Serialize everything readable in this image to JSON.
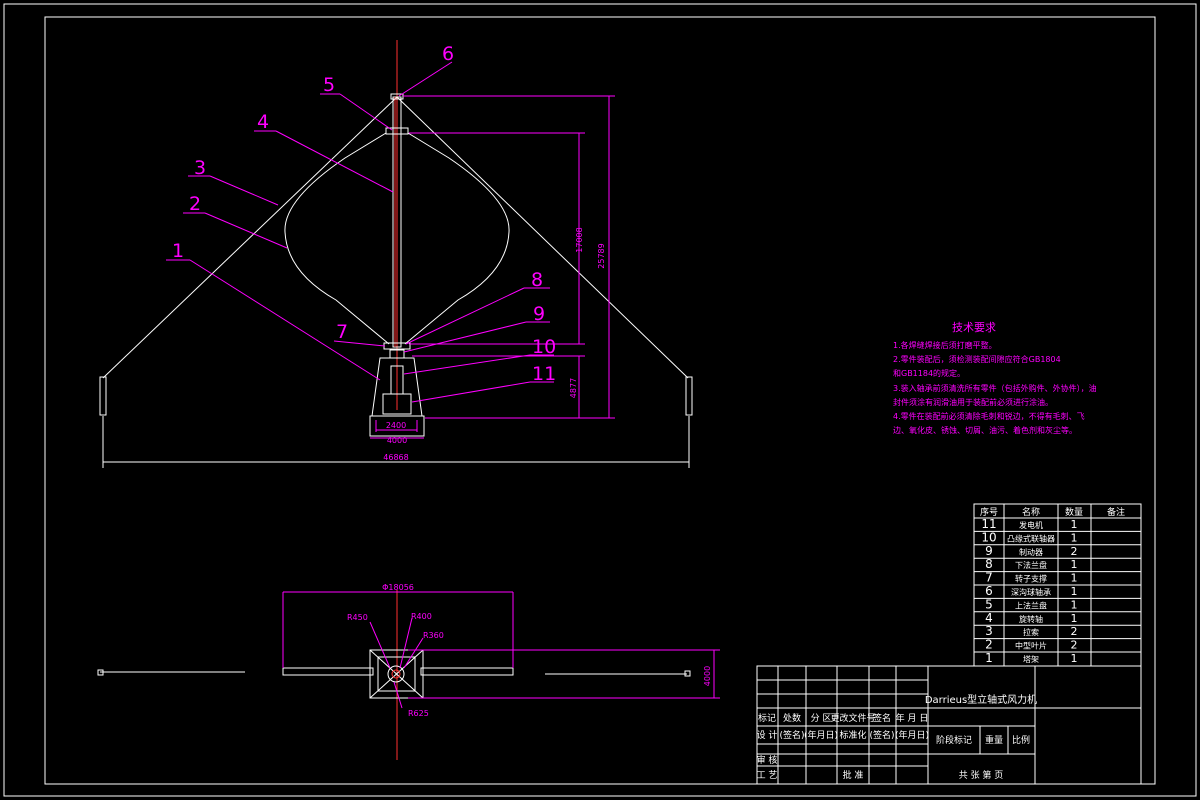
{
  "drawing": {
    "callouts": [
      "6",
      "5",
      "4",
      "3",
      "2",
      "1",
      "7",
      "8",
      "9",
      "10",
      "11"
    ],
    "dimensions": {
      "height_rotor": "17008",
      "height_total": "25789",
      "height_base": "4877",
      "base_inner": "2400",
      "base_outer": "4000",
      "span": "46868",
      "plan_diameter": "Φ18056",
      "r450": "R450",
      "r400": "R400",
      "r360": "R360",
      "r625": "R625",
      "plan_width": "4000"
    }
  },
  "tech_requirements": {
    "title": "技术要求",
    "lines": [
      "1.各焊缝焊接后须打磨平整。",
      "2.零件装配后，须检测装配间隙应符合GB1804",
      "和GB1184的规定。",
      "3.装入轴承前须清洗所有零件（包括外购件、外协件），油",
      "封件须涂有润滑油用于装配前必须进行涂油。",
      "4.零件在装配前必须清除毛刺和锐边，不得有毛刺、飞",
      "边、氧化皮、锈蚀、切屑、油污、着色剂和灰尘等。"
    ]
  },
  "parts_list": {
    "headers": [
      "序号",
      "名称",
      "数量",
      "备注"
    ],
    "rows": [
      {
        "no": "11",
        "name": "发电机",
        "qty": "1"
      },
      {
        "no": "10",
        "name": "凸缘式联轴器",
        "qty": "1"
      },
      {
        "no": "9",
        "name": "制动器",
        "qty": "2"
      },
      {
        "no": "8",
        "name": "下法兰盘",
        "qty": "1"
      },
      {
        "no": "7",
        "name": "转子支撑",
        "qty": "1"
      },
      {
        "no": "6",
        "name": "深沟球轴承",
        "qty": "1"
      },
      {
        "no": "5",
        "name": "上法兰盘",
        "qty": "1"
      },
      {
        "no": "4",
        "name": "旋转轴",
        "qty": "1"
      },
      {
        "no": "3",
        "name": "拉索",
        "qty": "2"
      },
      {
        "no": "2",
        "name": "中型叶片",
        "qty": "2"
      },
      {
        "no": "1",
        "name": "塔架",
        "qty": "1"
      }
    ]
  },
  "title_block": {
    "drawing_name": "Darrieus型立轴式风力机",
    "row1": [
      "标记",
      "处数",
      "分 区",
      "更改文件号",
      "签名",
      "年 月 日"
    ],
    "row2": [
      "设 计",
      "(签名)",
      "(年月日)",
      "标准化",
      "(签名)",
      "(年月日)"
    ],
    "row3_label": "审 核",
    "row4": [
      "工 艺",
      "批 准"
    ],
    "stage_label": "阶段标记",
    "weight_label": "重量",
    "scale_label": "比例",
    "sheet_label": "共    张  第    页"
  }
}
